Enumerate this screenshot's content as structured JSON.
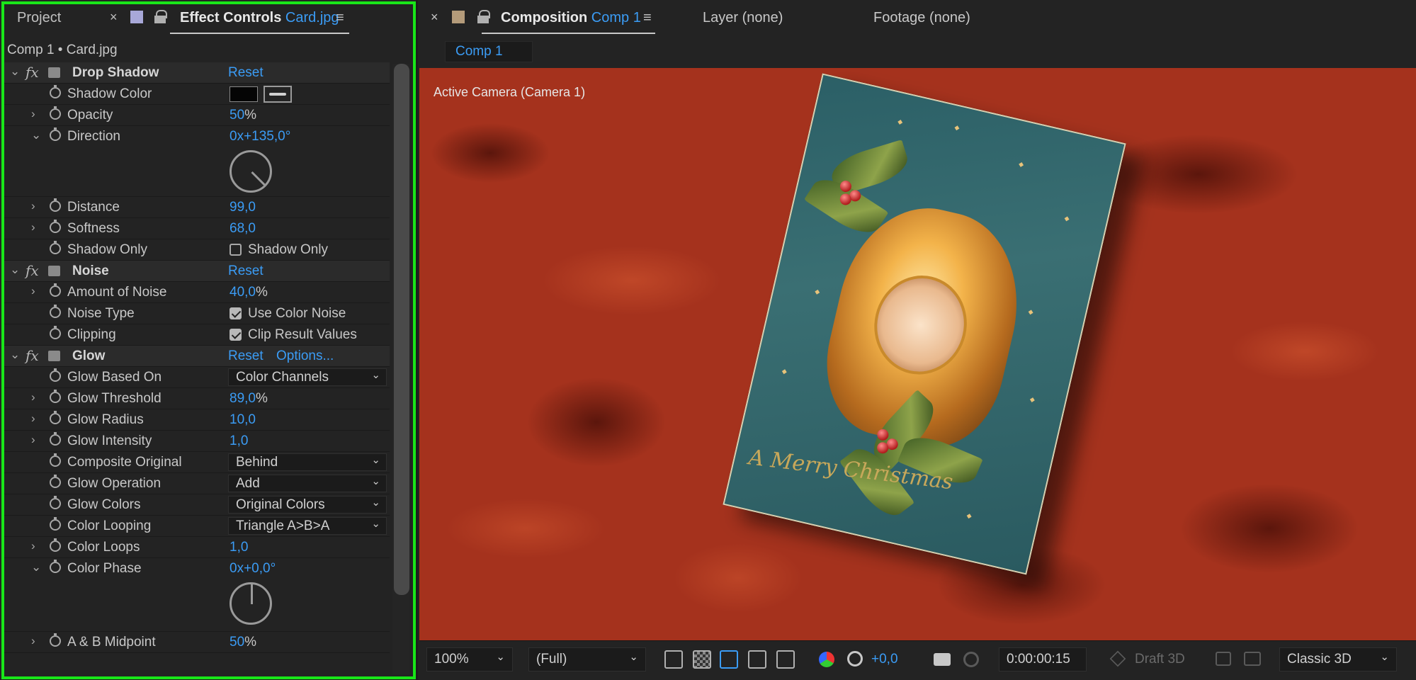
{
  "left_panel": {
    "tabs": {
      "project": "Project",
      "close": "×",
      "effect_controls": "Effect Controls",
      "layer_name": "Card.jpg",
      "menu": "≡"
    },
    "subhead": "Comp 1 • Card.jpg",
    "effects": {
      "drop_shadow": {
        "name": "Drop Shadow",
        "reset": "Reset",
        "shadow_color": {
          "label": "Shadow Color",
          "color": "#050505"
        },
        "opacity": {
          "label": "Opacity",
          "value": "50",
          "unit": "%"
        },
        "direction": {
          "label": "Direction",
          "value": "0x+135,0°",
          "angle_deg": 135
        },
        "distance": {
          "label": "Distance",
          "value": "99,0"
        },
        "softness": {
          "label": "Softness",
          "value": "68,0"
        },
        "shadow_only": {
          "label": "Shadow Only",
          "checkbox_label": "Shadow Only",
          "checked": false
        }
      },
      "noise": {
        "name": "Noise",
        "reset": "Reset",
        "amount": {
          "label": "Amount of Noise",
          "value": "40,0",
          "unit": "%"
        },
        "noise_type": {
          "label": "Noise Type",
          "checkbox_label": "Use Color Noise",
          "checked": true
        },
        "clipping": {
          "label": "Clipping",
          "checkbox_label": "Clip Result Values",
          "checked": true
        }
      },
      "glow": {
        "name": "Glow",
        "reset": "Reset",
        "options": "Options...",
        "based_on": {
          "label": "Glow Based On",
          "value": "Color Channels"
        },
        "threshold": {
          "label": "Glow Threshold",
          "value": "89,0",
          "unit": "%"
        },
        "radius": {
          "label": "Glow Radius",
          "value": "10,0"
        },
        "intensity": {
          "label": "Glow Intensity",
          "value": "1,0"
        },
        "composite": {
          "label": "Composite Original",
          "value": "Behind"
        },
        "operation": {
          "label": "Glow Operation",
          "value": "Add"
        },
        "colors": {
          "label": "Glow Colors",
          "value": "Original Colors"
        },
        "looping": {
          "label": "Color Looping",
          "value": "Triangle A>B>A"
        },
        "loops": {
          "label": "Color Loops",
          "value": "1,0"
        },
        "phase": {
          "label": "Color Phase",
          "value": "0x+0,0°",
          "angle_deg": 0
        },
        "midpoint": {
          "label": "A & B Midpoint",
          "value": "50",
          "unit": "%"
        }
      }
    }
  },
  "right_panel": {
    "tabs": {
      "close": "×",
      "composition": "Composition",
      "comp_name": "Comp 1",
      "menu": "≡",
      "layer": "Layer (none)",
      "footage": "Footage (none)"
    },
    "subtab": "Comp 1",
    "camera_label": "Active Camera (Camera 1)",
    "card_text": "A Merry Christmas",
    "toolbar": {
      "zoom": "100%",
      "resolution": "(Full)",
      "exposure": "+0,0",
      "timecode": "0:00:00:15",
      "draft3d": "Draft 3D",
      "renderer": "Classic 3D"
    }
  },
  "colors": {
    "accent_blue": "#3b9cf5",
    "highlight_green": "#19e619"
  }
}
